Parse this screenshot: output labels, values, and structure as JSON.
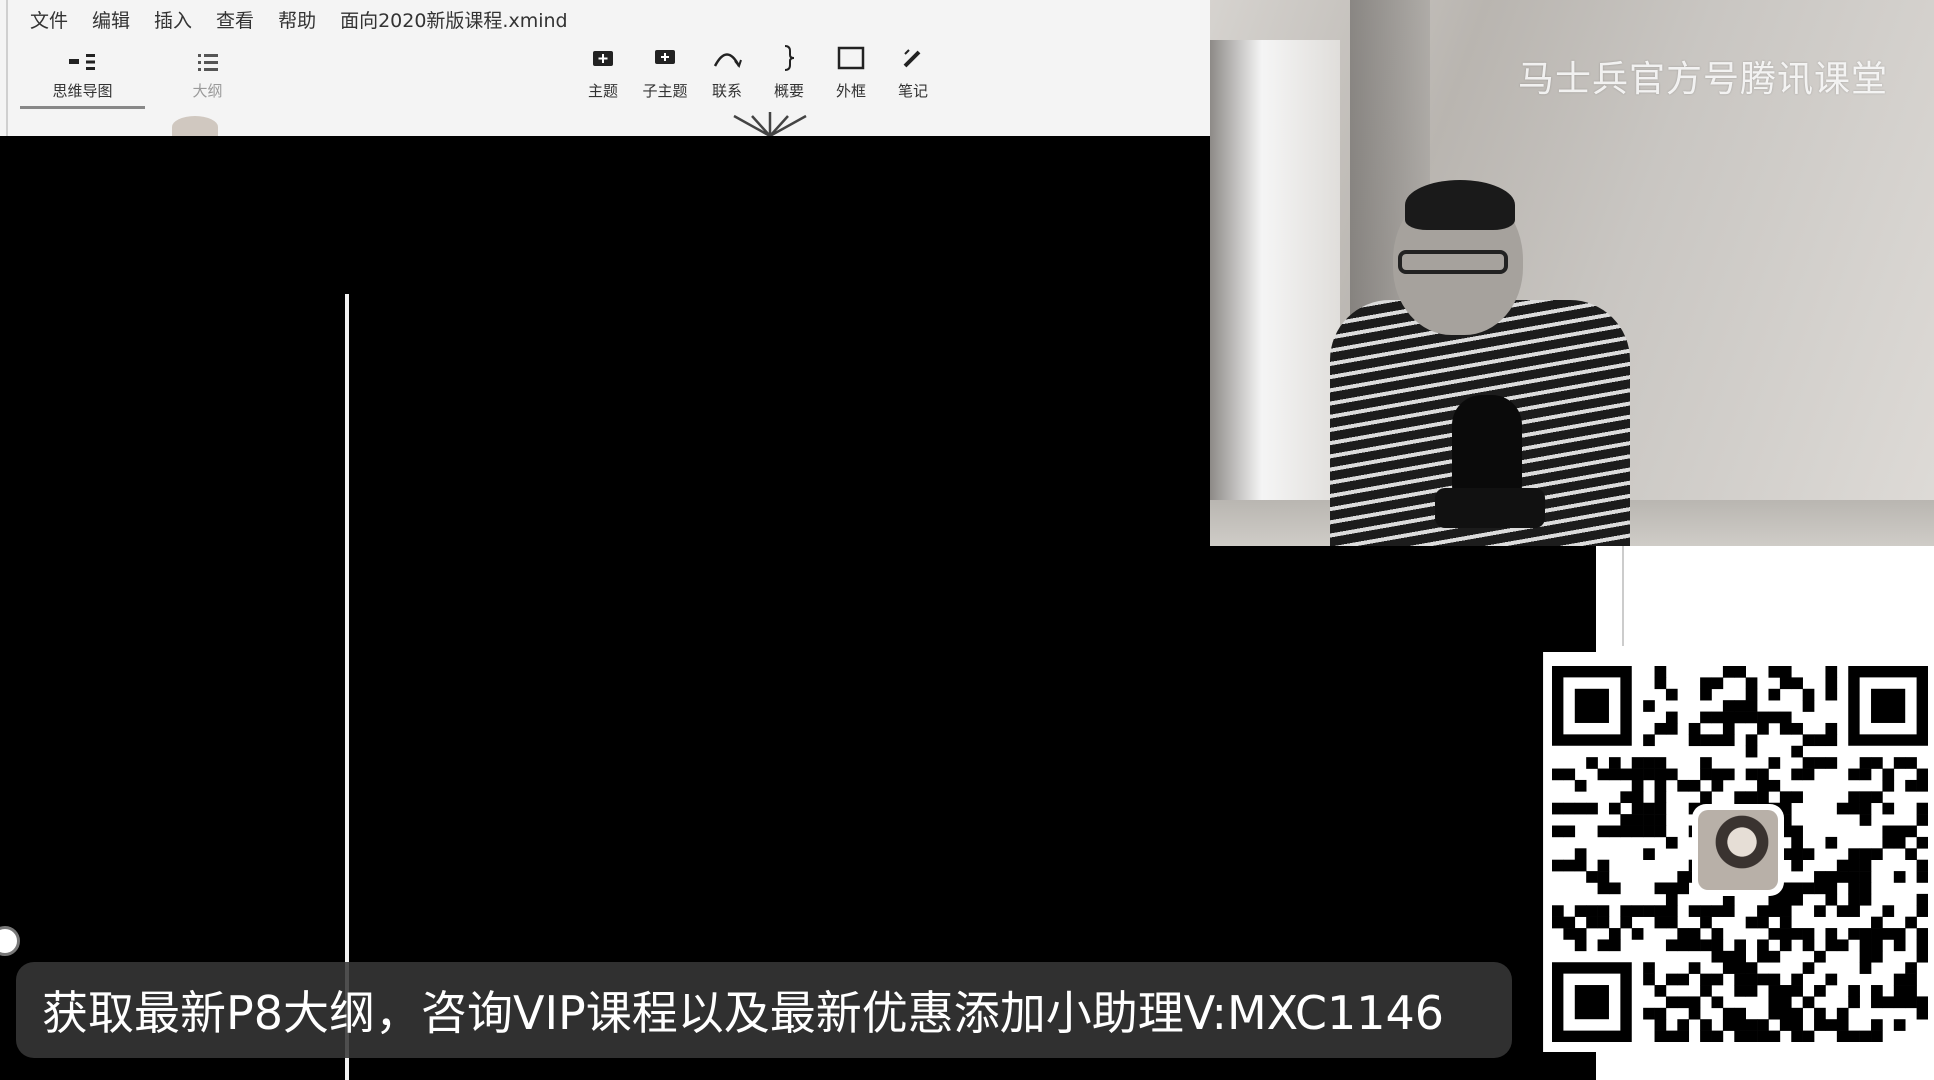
{
  "menu": {
    "items": [
      "文件",
      "编辑",
      "插入",
      "查看",
      "帮助"
    ],
    "document_title": "面向2020新版课程.xmind"
  },
  "view_switch": {
    "mindmap_label": "思维导图",
    "outline_label": "大纲",
    "active": "mindmap"
  },
  "toolbar": {
    "topic_label": "主题",
    "subtopic_label": "子主题",
    "relationship_label": "联系",
    "summary_label": "概要",
    "boundary_label": "外框",
    "note_label": "笔记"
  },
  "webcam": {
    "watermark": "马士兵官方号腾讯课堂"
  },
  "banner": {
    "text": "获取最新P8大纲，咨询VIP课程以及最新优惠添加小助理V:MXC1146"
  },
  "colors": {
    "app_bg": "#f4f4f4",
    "canvas_bg": "#000000",
    "banner_bg": "#373737",
    "banner_text": "#ffffff"
  }
}
